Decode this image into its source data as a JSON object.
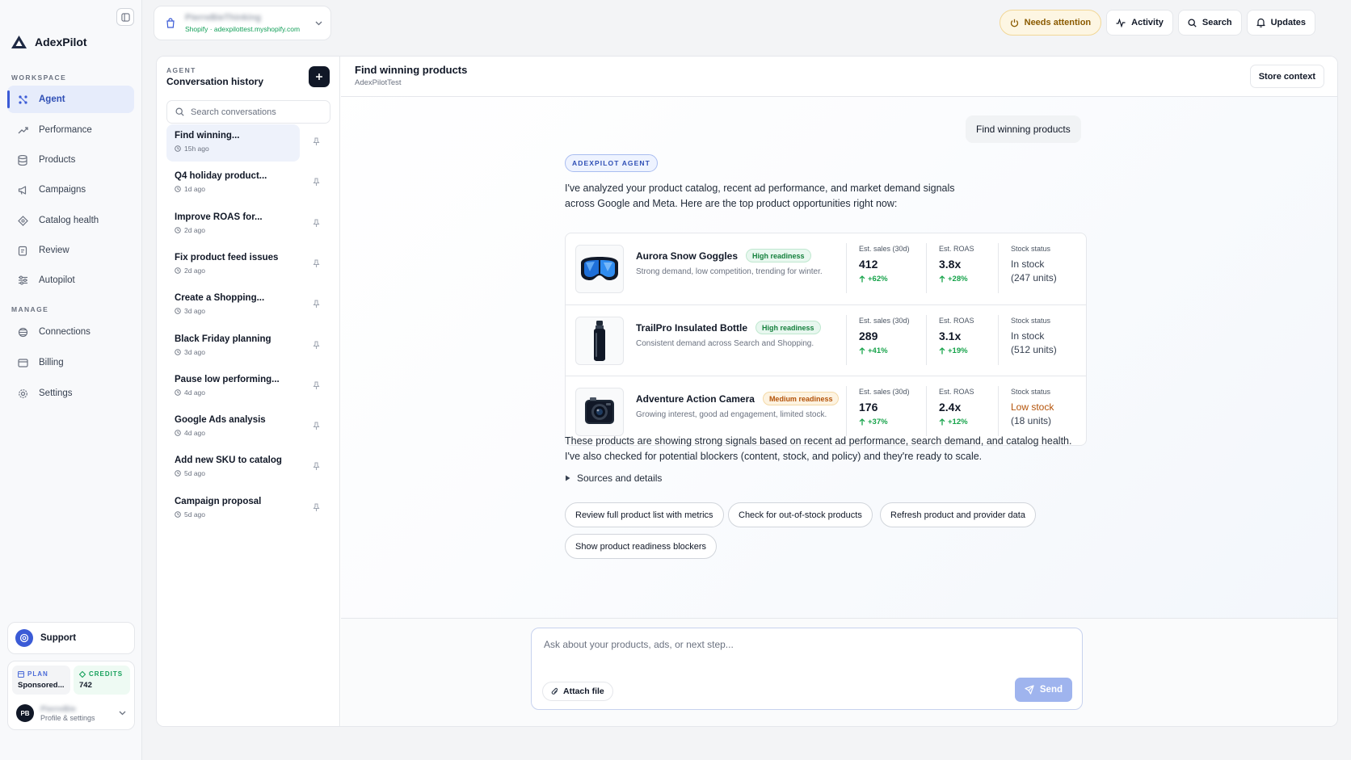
{
  "brand": {
    "name": "AdexPilot"
  },
  "sidebar": {
    "workspace_label": "WORKSPACE",
    "manage_label": "MANAGE",
    "workspace_items": [
      {
        "label": "Agent",
        "icon": "agent-grid-icon"
      },
      {
        "label": "Performance",
        "icon": "trending-up-icon"
      },
      {
        "label": "Products",
        "icon": "database-icon"
      },
      {
        "label": "Campaigns",
        "icon": "megaphone-icon"
      },
      {
        "label": "Catalog health",
        "icon": "tag-icon"
      },
      {
        "label": "Review",
        "icon": "clipboard-icon"
      },
      {
        "label": "Autopilot",
        "icon": "sliders-icon"
      }
    ],
    "manage_items": [
      {
        "label": "Connections",
        "icon": "connections-icon"
      },
      {
        "label": "Billing",
        "icon": "card-icon"
      },
      {
        "label": "Settings",
        "icon": "gear-icon"
      }
    ],
    "support_label": "Support",
    "plan": {
      "label": "PLAN",
      "value": "Sponsored..."
    },
    "credits": {
      "label": "CREDITS",
      "value": "742"
    },
    "profile": {
      "initials": "PB",
      "name": "PierreBie",
      "subtitle": "Profile & settings"
    }
  },
  "store": {
    "name": "PierreBieThinking",
    "subtitle": "Shopify · adexpilottest.myshopify.com"
  },
  "top_actions": {
    "needs_attention": "Needs attention",
    "activity": "Activity",
    "search": "Search",
    "updates": "Updates"
  },
  "conversations": {
    "kicker": "AGENT",
    "title": "Conversation history",
    "search_placeholder": "Search conversations",
    "items": [
      {
        "title": "Find winning...",
        "time": "15h ago"
      },
      {
        "title": "Q4 holiday product...",
        "time": "1d ago"
      },
      {
        "title": "Improve ROAS for...",
        "time": "2d ago"
      },
      {
        "title": "Fix product feed issues",
        "time": "2d ago"
      },
      {
        "title": "Create a Shopping...",
        "time": "3d ago"
      },
      {
        "title": "Black Friday planning",
        "time": "3d ago"
      },
      {
        "title": "Pause low performing...",
        "time": "4d ago"
      },
      {
        "title": "Google Ads analysis",
        "time": "4d ago"
      },
      {
        "title": "Add new SKU to catalog",
        "time": "5d ago"
      },
      {
        "title": "Campaign proposal",
        "time": "5d ago"
      }
    ]
  },
  "chat": {
    "title": "Find winning products",
    "subtitle": "AdexPilotTest",
    "store_context_label": "Store context",
    "user_message": "Find winning products",
    "agent_badge": "ADEXPILOT AGENT",
    "intro_line1": "I've analyzed your product catalog, recent ad performance, and market demand signals",
    "intro_line2": "across Google and Meta. Here are the top product opportunities right now:",
    "products": [
      {
        "name": "Aurora Snow Goggles",
        "readiness": "High readiness",
        "readiness_level": "high",
        "description": "Strong demand, low competition, trending for winter.",
        "sales_label": "Est. sales (30d)",
        "sales": "412",
        "sales_delta": "+62%",
        "roas_label": "Est. ROAS",
        "roas": "3.8x",
        "roas_delta": "+28%",
        "stock_label": "Stock status",
        "stock": "In stock",
        "stock_units": "(247 units)",
        "stock_level": "ok",
        "image_icon": "goggles-icon"
      },
      {
        "name": "TrailPro Insulated Bottle",
        "readiness": "High readiness",
        "readiness_level": "high",
        "description": "Consistent demand across Search and Shopping.",
        "sales_label": "Est. sales (30d)",
        "sales": "289",
        "sales_delta": "+41%",
        "roas_label": "Est. ROAS",
        "roas": "3.1x",
        "roas_delta": "+19%",
        "stock_label": "Stock status",
        "stock": "In stock",
        "stock_units": "(512 units)",
        "stock_level": "ok",
        "image_icon": "bottle-icon"
      },
      {
        "name": "Adventure Action Camera",
        "readiness": "Medium readiness",
        "readiness_level": "medium",
        "description": "Growing interest, good ad engagement, limited stock.",
        "sales_label": "Est. sales (30d)",
        "sales": "176",
        "sales_delta": "+37%",
        "roas_label": "Est. ROAS",
        "roas": "2.4x",
        "roas_delta": "+12%",
        "stock_label": "Stock status",
        "stock": "Low stock",
        "stock_units": "(18 units)",
        "stock_level": "low",
        "image_icon": "camera-icon"
      }
    ],
    "summary_line1": "These products are showing strong signals based on recent ad performance, search demand, and catalog health.",
    "summary_line2": "I've also checked for potential blockers (content, stock, and policy) and they're ready to scale.",
    "sources_label": "Sources and details",
    "suggestions": [
      "Review full product list with metrics",
      "Check for out-of-stock products",
      "Refresh product and provider data",
      "Show product readiness blockers"
    ]
  },
  "composer": {
    "placeholder": "Ask about your products, ads, or next step...",
    "attach_label": "Attach file",
    "send_label": "Send"
  },
  "colors": {
    "accent": "#3b5bd6",
    "positive": "#16a34a",
    "warning": "#b45309",
    "dark": "#111827"
  }
}
